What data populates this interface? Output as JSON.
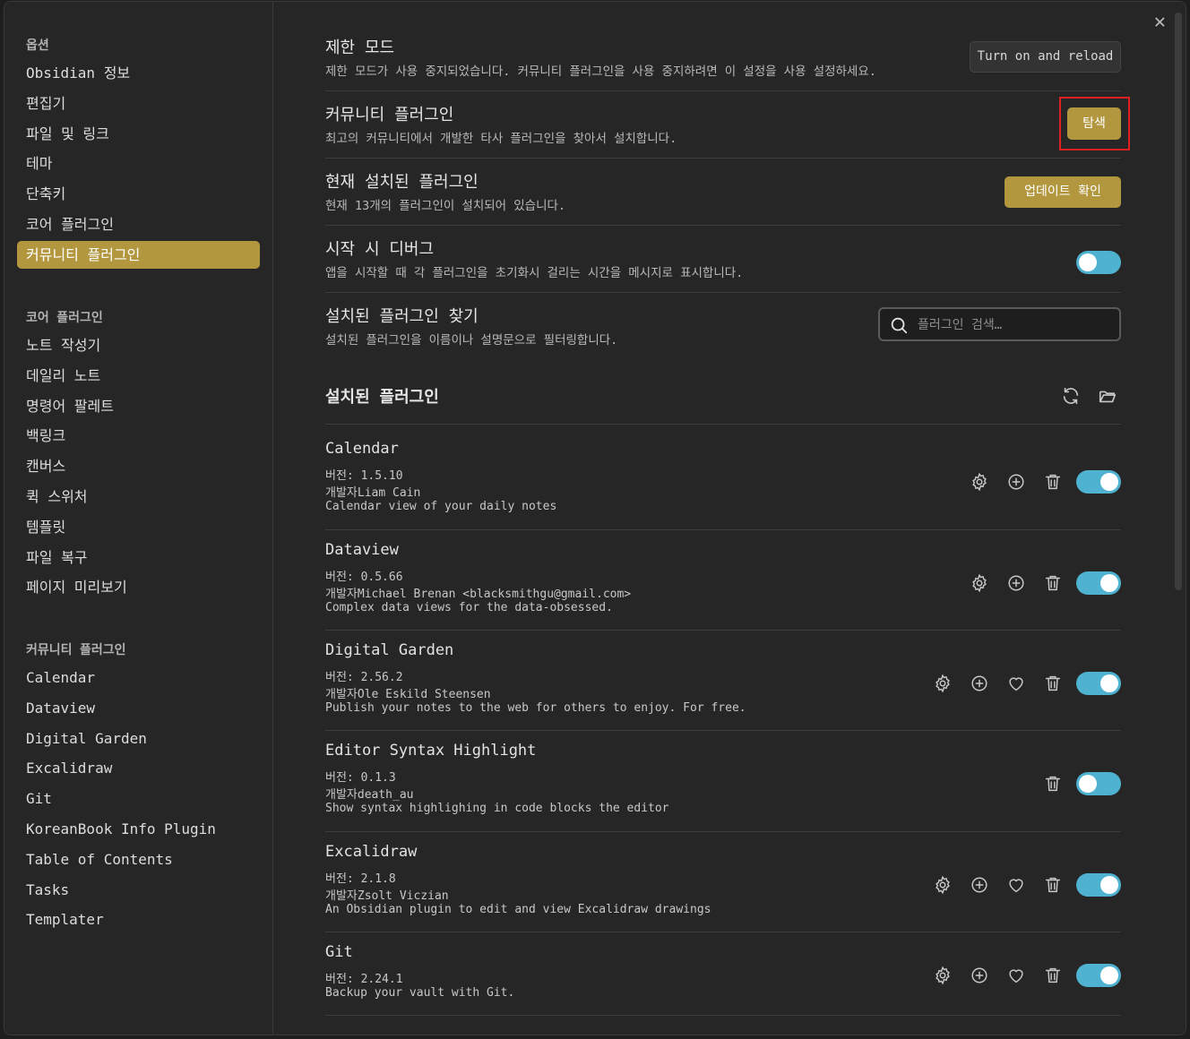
{
  "sidebar": {
    "sections": [
      {
        "heading": "옵션",
        "items": [
          "Obsidian 정보",
          "편집기",
          "파일 및 링크",
          "테마",
          "단축키",
          "코어 플러그인",
          "커뮤니티 플러그인"
        ]
      },
      {
        "heading": "코어 플러그인",
        "items": [
          "노트 작성기",
          "데일리 노트",
          "명령어 팔레트",
          "백링크",
          "캔버스",
          "퀵 스위처",
          "템플릿",
          "파일 복구",
          "페이지 미리보기"
        ]
      },
      {
        "heading": "커뮤니티 플러그인",
        "items": [
          "Calendar",
          "Dataview",
          "Digital Garden",
          "Excalidraw",
          "Git",
          "KoreanBook Info Plugin",
          "Table of Contents",
          "Tasks",
          "Templater"
        ]
      }
    ],
    "active_item": "커뮤니티 플러그인"
  },
  "settings": {
    "restricted": {
      "title": "제한 모드",
      "desc": "제한 모드가 사용 중지되었습니다. 커뮤니티 플러그인을 사용 중지하려면 이 설정을 사용 설정하세요.",
      "button": "Turn on and reload"
    },
    "community": {
      "title": "커뮤니티 플러그인",
      "desc": "최고의 커뮤니티에서 개발한 타사 플러그인을 찾아서 설치합니다.",
      "button": "탐색"
    },
    "installed": {
      "title": "현재 설치된 플러그인",
      "desc": "현재 13개의 플러그인이 설치되어 있습니다.",
      "button": "업데이트 확인"
    },
    "debug": {
      "title": "시작 시 디버그",
      "desc": "앱을 시작할 때 각 플러그인을 초기화시 걸리는 시간을 메시지로 표시합니다.",
      "enabled": false
    },
    "search": {
      "title": "설치된 플러그인 찾기",
      "desc": "설치된 플러그인을 이름이나 설명문으로 필터링합니다.",
      "placeholder": "플러그인 검색…"
    }
  },
  "installed_heading": "설치된 플러그인",
  "plugins": [
    {
      "name": "Calendar",
      "version": "버전: 1.5.10",
      "author": "개발자Liam Cain",
      "desc": "Calendar view of your daily notes",
      "icons": [
        "gear",
        "plus"
      ],
      "enabled": true
    },
    {
      "name": "Dataview",
      "version": "버전: 0.5.66",
      "author": "개발자Michael Brenan <blacksmithgu@gmail.com>",
      "desc": "Complex data views for the data-obsessed.",
      "icons": [
        "gear",
        "plus"
      ],
      "enabled": true
    },
    {
      "name": "Digital Garden",
      "version": "버전: 2.56.2",
      "author": "개발자Ole Eskild Steensen",
      "desc": "Publish your notes to the web for others to enjoy. For free.",
      "icons": [
        "gear",
        "plus",
        "heart"
      ],
      "enabled": true
    },
    {
      "name": "Editor Syntax Highlight",
      "version": "버전: 0.1.3",
      "author": "개발자death_au",
      "desc": "Show syntax highlighing in code blocks the editor",
      "icons": [],
      "enabled": false
    },
    {
      "name": "Excalidraw",
      "version": "버전: 2.1.8",
      "author": "개발자Zsolt Viczian",
      "desc": "An Obsidian plugin to edit and view Excalidraw drawings",
      "icons": [
        "gear",
        "plus",
        "heart"
      ],
      "enabled": true
    },
    {
      "name": "Git",
      "version": "버전: 2.24.1",
      "author": "",
      "desc": "Backup your vault with Git.",
      "icons": [
        "gear",
        "plus",
        "heart"
      ],
      "enabled": true
    }
  ],
  "colors": {
    "accent": "#b3973f",
    "toggle_on": "#4fb2d1",
    "highlight": "#e02020"
  }
}
